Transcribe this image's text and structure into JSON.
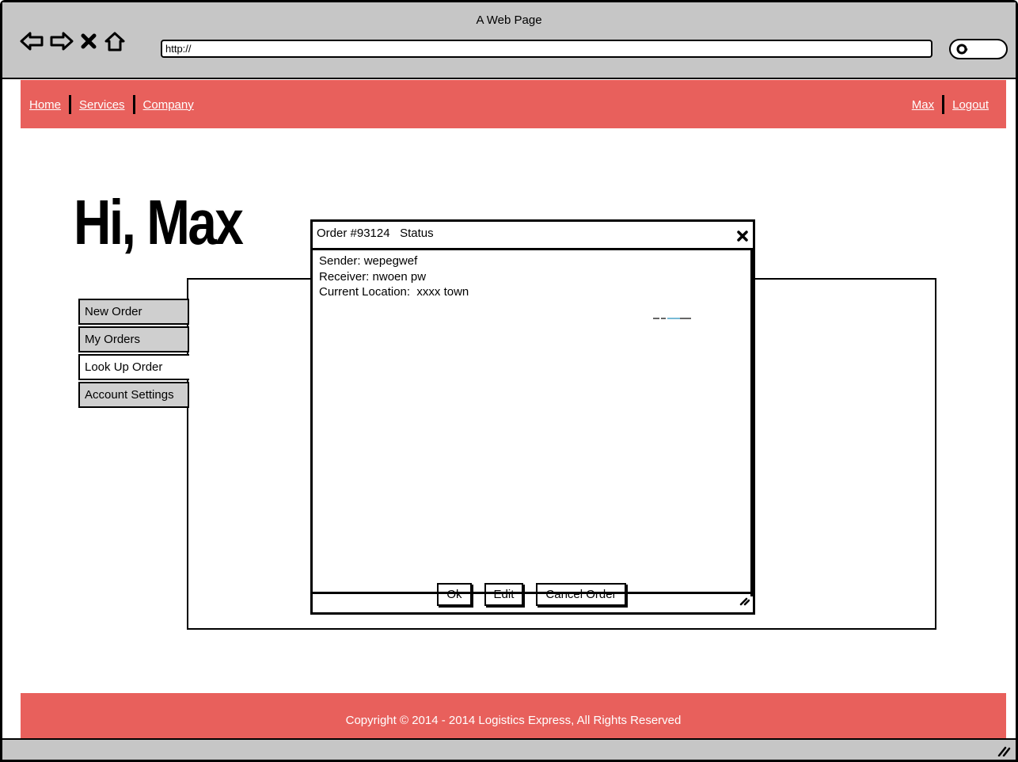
{
  "window": {
    "title": "A Web Page"
  },
  "browser": {
    "url": "http://"
  },
  "nav": {
    "left": [
      "Home",
      "Services",
      "Company"
    ],
    "right": [
      "Max",
      "Logout"
    ]
  },
  "greeting": "Hi, Max",
  "tabs": [
    "New Order",
    "My Orders",
    "Look Up Order",
    "Account Settings"
  ],
  "active_tab": "Look Up Order",
  "dialog": {
    "title": "Order #93124   Status",
    "lines": [
      "Sender: wepegwef",
      "Receiver: nwoen pw",
      "Current Location:  xxxx town"
    ],
    "buttons": {
      "ok": "Ok",
      "edit": "Edit",
      "cancel": "Cancel Order"
    }
  },
  "footer": {
    "text": "Copyright © 2014 - 2014 Logistics Express, All Rights Reserved"
  },
  "colors": {
    "accent": "#e8605c",
    "chrome": "#c6c6c6",
    "tab_inactive": "#cfcfcf"
  }
}
